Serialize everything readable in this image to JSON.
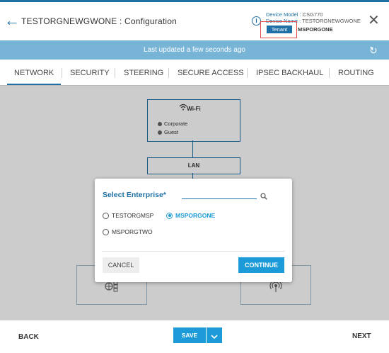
{
  "header": {
    "title": "TESTORGNEWGWONE : Configuration",
    "device_model_label": "Device Model :",
    "device_model_value": "CSG770",
    "device_name_label": "Device Name :",
    "device_name_value": "TESTORGNEWGWONE",
    "tenant_badge": "Tenant",
    "tenant_name": "MSPORGONE",
    "info_icon": "info-icon",
    "close_icon": "close-icon"
  },
  "banner": {
    "text": "Last updated a few seconds ago"
  },
  "tabs": [
    {
      "label": "NETWORK",
      "active": true
    },
    {
      "label": "SECURITY"
    },
    {
      "label": "STEERING"
    },
    {
      "label": "SECURE ACCESS"
    },
    {
      "label": "IPSEC BACKHAUL"
    },
    {
      "label": "ROUTING"
    }
  ],
  "diagram": {
    "wifi_title": "Wi-Fi",
    "wifi_items": [
      "Corporate",
      "Guest"
    ],
    "lan_label": "LAN"
  },
  "modal": {
    "title": "Select Enterprise*",
    "search_value": "",
    "options": [
      {
        "label": "TESTORGMSP",
        "checked": false
      },
      {
        "label": "MSPORGONE",
        "checked": true
      },
      {
        "label": "MSPORGTWO",
        "checked": false
      }
    ],
    "cancel_label": "CANCEL",
    "continue_label": "CONTINUE"
  },
  "footer": {
    "back_label": "BACK",
    "save_label": "SAVE",
    "next_label": "NEXT"
  },
  "colors": {
    "primary": "#1d6fa5",
    "accent": "#1d9bd8",
    "banner": "#78b4d6",
    "highlight_box": "#e04848"
  }
}
